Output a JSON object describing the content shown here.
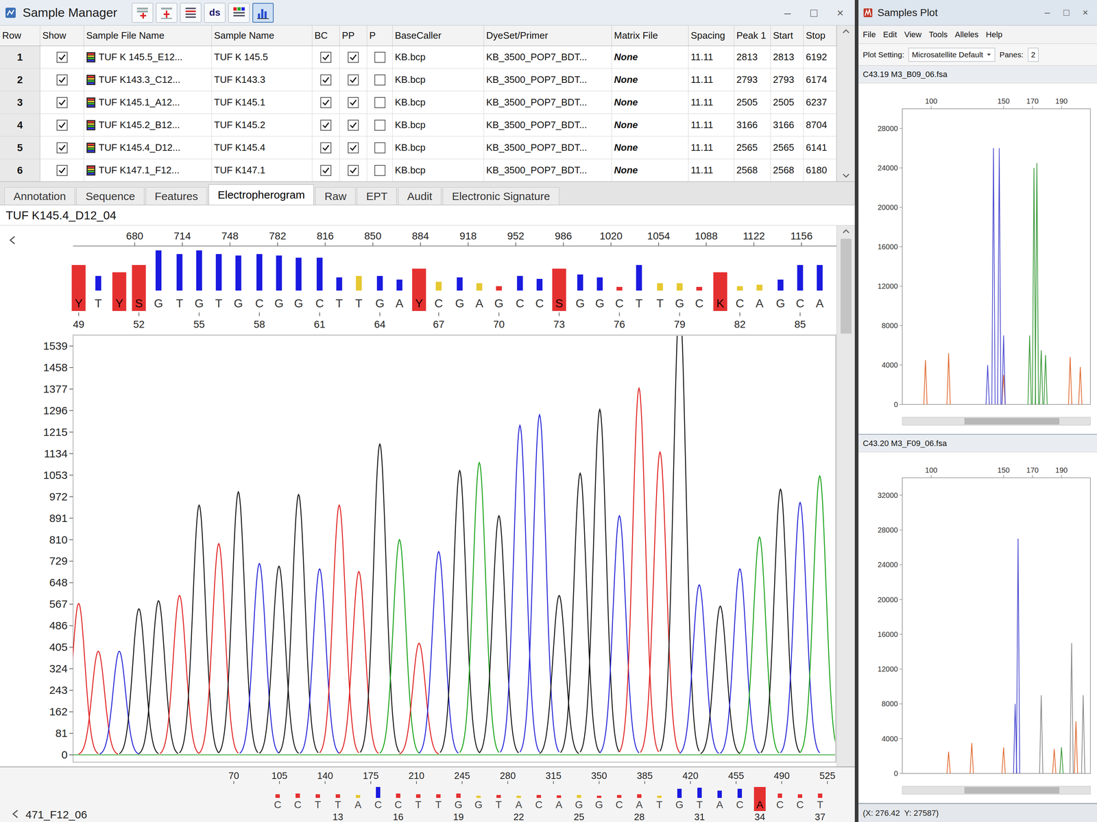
{
  "window": {
    "title": "Sample Manager",
    "controls": [
      "–",
      "□",
      "×"
    ]
  },
  "toolbar": [
    {
      "kind": "add",
      "selected": false
    },
    {
      "kind": "insert",
      "selected": false
    },
    {
      "kind": "align",
      "selected": false
    },
    {
      "kind": "text",
      "label": "ds",
      "selected": false
    },
    {
      "kind": "grid",
      "selected": false
    },
    {
      "kind": "chart",
      "selected": true
    }
  ],
  "table": {
    "columns": [
      "Row",
      "Show",
      "Sample File Name",
      "Sample Name",
      "BC",
      "PP",
      "P",
      "BaseCaller",
      "DyeSet/Primer",
      "Matrix File",
      "Spacing",
      "Peak 1",
      "Start",
      "Stop"
    ],
    "rows": [
      {
        "row": "1",
        "show": true,
        "file": "TUF K 145.5_E12...",
        "sample": "TUF K 145.5",
        "bc": true,
        "pp": true,
        "p": false,
        "basecaller": "KB.bcp",
        "dyeset": "KB_3500_POP7_BDT...",
        "matrix": "None",
        "spacing": "11.11",
        "peak1": "2813",
        "start": "2813",
        "stop": "6192"
      },
      {
        "row": "2",
        "show": true,
        "file": "TUF K143.3_C12...",
        "sample": "TUF K143.3",
        "bc": true,
        "pp": true,
        "p": false,
        "basecaller": "KB.bcp",
        "dyeset": "KB_3500_POP7_BDT...",
        "matrix": "None",
        "spacing": "11.11",
        "peak1": "2793",
        "start": "2793",
        "stop": "6174"
      },
      {
        "row": "3",
        "show": true,
        "file": "TUF K145.1_A12...",
        "sample": "TUF K145.1",
        "bc": true,
        "pp": true,
        "p": false,
        "basecaller": "KB.bcp",
        "dyeset": "KB_3500_POP7_BDT...",
        "matrix": "None",
        "spacing": "11.11",
        "peak1": "2505",
        "start": "2505",
        "stop": "6237"
      },
      {
        "row": "4",
        "show": true,
        "file": "TUF K145.2_B12...",
        "sample": "TUF K145.2",
        "bc": true,
        "pp": true,
        "p": false,
        "basecaller": "KB.bcp",
        "dyeset": "KB_3500_POP7_BDT...",
        "matrix": "None",
        "spacing": "11.11",
        "peak1": "3166",
        "start": "3166",
        "stop": "8704"
      },
      {
        "row": "5",
        "show": true,
        "file": "TUF K145.4_D12...",
        "sample": "TUF K145.4",
        "bc": true,
        "pp": true,
        "p": false,
        "basecaller": "KB.bcp",
        "dyeset": "KB_3500_POP7_BDT...",
        "matrix": "None",
        "spacing": "11.11",
        "peak1": "2565",
        "start": "2565",
        "stop": "6141"
      },
      {
        "row": "6",
        "show": true,
        "file": "TUF K147.1_F12...",
        "sample": "TUF K147.1",
        "bc": true,
        "pp": true,
        "p": false,
        "basecaller": "KB.bcp",
        "dyeset": "KB_3500_POP7_BDT...",
        "matrix": "None",
        "spacing": "11.11",
        "peak1": "2568",
        "start": "2568",
        "stop": "6180"
      }
    ]
  },
  "tabs": [
    {
      "label": "Annotation",
      "selected": false
    },
    {
      "label": "Sequence",
      "selected": false
    },
    {
      "label": "Features",
      "selected": false
    },
    {
      "label": "Electropherogram",
      "selected": true
    },
    {
      "label": "Raw",
      "selected": false
    },
    {
      "label": "EPT",
      "selected": false
    },
    {
      "label": "Audit",
      "selected": false
    },
    {
      "label": "Electronic Signature",
      "selected": false
    }
  ],
  "electropherogram": {
    "title": "TUF K145.4_D12_04",
    "scan_range": [
      636,
      1181
    ],
    "y_max": 1539,
    "x_ticks": [
      "680",
      "714",
      "748",
      "782",
      "816",
      "850",
      "884",
      "918",
      "952",
      "986",
      "1020",
      "1054",
      "1088",
      "1122",
      "1156"
    ],
    "y_ticks": [
      "1539",
      "1458",
      "1377",
      "1296",
      "1215",
      "1134",
      "1053",
      "972",
      "891",
      "810",
      "729",
      "648",
      "567",
      "486",
      "405",
      "324",
      "243",
      "162",
      "81",
      "0"
    ],
    "calls": [
      {
        "base": "Y",
        "scan": 640,
        "peak": 570,
        "color": "#e02020",
        "q": 0.35,
        "qc": "#e53030",
        "low": true,
        "num": "49"
      },
      {
        "base": "T",
        "scan": 654,
        "peak": 390,
        "color": "#e02020",
        "q": 0.2,
        "qc": "#1a1ae0",
        "low": false
      },
      {
        "base": "Y",
        "scan": 669,
        "peak": 390,
        "color": "#2525d8",
        "q": 0.25,
        "qc": "#e53030",
        "low": true
      },
      {
        "base": "S",
        "scan": 683,
        "peak": 550,
        "color": "#111111",
        "q": 0.35,
        "qc": "#e53030",
        "low": true,
        "num": "52"
      },
      {
        "base": "G",
        "scan": 697,
        "peak": 580,
        "color": "#111111",
        "q": 0.55,
        "qc": "#1a1ae0",
        "low": false
      },
      {
        "base": "T",
        "scan": 712,
        "peak": 600,
        "color": "#e02020",
        "q": 0.5,
        "qc": "#1a1ae0",
        "low": false
      },
      {
        "base": "G",
        "scan": 726,
        "peak": 940,
        "color": "#111111",
        "q": 0.55,
        "qc": "#1a1ae0",
        "low": false,
        "num": "55"
      },
      {
        "base": "T",
        "scan": 740,
        "peak": 795,
        "color": "#e02020",
        "q": 0.5,
        "qc": "#1a1ae0",
        "low": false
      },
      {
        "base": "G",
        "scan": 754,
        "peak": 990,
        "color": "#111111",
        "q": 0.48,
        "qc": "#1a1ae0",
        "low": false
      },
      {
        "base": "C",
        "scan": 769,
        "peak": 720,
        "color": "#2525d8",
        "q": 0.5,
        "qc": "#1a1ae0",
        "low": false,
        "num": "58"
      },
      {
        "base": "G",
        "scan": 783,
        "peak": 710,
        "color": "#111111",
        "q": 0.48,
        "qc": "#1a1ae0",
        "low": false
      },
      {
        "base": "G",
        "scan": 797,
        "peak": 980,
        "color": "#111111",
        "q": 0.45,
        "qc": "#1a1ae0",
        "low": false
      },
      {
        "base": "C",
        "scan": 812,
        "peak": 700,
        "color": "#2525d8",
        "q": 0.45,
        "qc": "#1a1ae0",
        "low": false,
        "num": "61"
      },
      {
        "base": "T",
        "scan": 826,
        "peak": 940,
        "color": "#e02020",
        "q": 0.18,
        "qc": "#1a1ae0",
        "low": false
      },
      {
        "base": "T",
        "scan": 840,
        "peak": 690,
        "color": "#e02020",
        "q": 0.2,
        "qc": "#e6c830",
        "low": false
      },
      {
        "base": "G",
        "scan": 855,
        "peak": 1170,
        "color": "#111111",
        "q": 0.2,
        "qc": "#1a1ae0",
        "low": false,
        "num": "64"
      },
      {
        "base": "A",
        "scan": 869,
        "peak": 810,
        "color": "#1aa31a",
        "q": 0.15,
        "qc": "#1a1ae0",
        "low": false
      },
      {
        "base": "Y",
        "scan": 883,
        "peak": 420,
        "color": "#e02020",
        "q": 0.3,
        "qc": "#e53030",
        "low": true
      },
      {
        "base": "C",
        "scan": 897,
        "peak": 765,
        "color": "#2525d8",
        "q": 0.12,
        "qc": "#e6c830",
        "low": false,
        "num": "67"
      },
      {
        "base": "G",
        "scan": 912,
        "peak": 1070,
        "color": "#111111",
        "q": 0.18,
        "qc": "#1a1ae0",
        "low": false
      },
      {
        "base": "A",
        "scan": 926,
        "peak": 1100,
        "color": "#1aa31a",
        "q": 0.1,
        "qc": "#e6c830",
        "low": false
      },
      {
        "base": "G",
        "scan": 940,
        "peak": 900,
        "color": "#111111",
        "q": 0.06,
        "qc": "#e53030",
        "low": false,
        "num": "70"
      },
      {
        "base": "C",
        "scan": 955,
        "peak": 1240,
        "color": "#2525d8",
        "q": 0.2,
        "qc": "#1a1ae0",
        "low": false
      },
      {
        "base": "C",
        "scan": 969,
        "peak": 1280,
        "color": "#2525d8",
        "q": 0.16,
        "qc": "#1a1ae0",
        "low": false
      },
      {
        "base": "S",
        "scan": 983,
        "peak": 600,
        "color": "#111111",
        "q": 0.3,
        "qc": "#e53030",
        "low": true,
        "num": "73"
      },
      {
        "base": "G",
        "scan": 998,
        "peak": 1060,
        "color": "#111111",
        "q": 0.22,
        "qc": "#1a1ae0",
        "low": false
      },
      {
        "base": "G",
        "scan": 1012,
        "peak": 1300,
        "color": "#111111",
        "q": 0.18,
        "qc": "#1a1ae0",
        "low": false
      },
      {
        "base": "C",
        "scan": 1026,
        "peak": 900,
        "color": "#2525d8",
        "q": 0.05,
        "qc": "#e53030",
        "low": false,
        "num": "76"
      },
      {
        "base": "T",
        "scan": 1040,
        "peak": 1380,
        "color": "#e02020",
        "q": 0.35,
        "qc": "#1a1ae0",
        "low": false
      },
      {
        "base": "T",
        "scan": 1055,
        "peak": 1140,
        "color": "#e02020",
        "q": 0.1,
        "qc": "#e6c830",
        "low": false
      },
      {
        "base": "G",
        "scan": 1069,
        "peak": 1700,
        "color": "#111111",
        "q": 0.1,
        "qc": "#e6c830",
        "low": false,
        "num": "79"
      },
      {
        "base": "C",
        "scan": 1083,
        "peak": 640,
        "color": "#2525d8",
        "q": 0.05,
        "qc": "#e53030",
        "low": false
      },
      {
        "base": "K",
        "scan": 1098,
        "peak": 560,
        "color": "#111111",
        "q": 0.25,
        "qc": "#e53030",
        "low": true
      },
      {
        "base": "C",
        "scan": 1112,
        "peak": 700,
        "color": "#2525d8",
        "q": 0.06,
        "qc": "#e6c830",
        "low": false,
        "num": "82"
      },
      {
        "base": "A",
        "scan": 1126,
        "peak": 820,
        "color": "#1aa31a",
        "q": 0.08,
        "qc": "#e6c830",
        "low": false
      },
      {
        "base": "G",
        "scan": 1141,
        "peak": 1000,
        "color": "#111111",
        "q": 0.15,
        "qc": "#1a1ae0",
        "low": false
      },
      {
        "base": "C",
        "scan": 1155,
        "peak": 950,
        "color": "#2525d8",
        "q": 0.35,
        "qc": "#1a1ae0",
        "low": false,
        "num": "85"
      },
      {
        "base": "A",
        "scan": 1169,
        "peak": 1050,
        "color": "#1aa31a",
        "q": 0.35,
        "qc": "#1a1ae0",
        "low": false
      }
    ]
  },
  "lower_panel": {
    "title": "471_F12_06",
    "x_ticks": [
      "70",
      "105",
      "140",
      "175",
      "210",
      "245",
      "280",
      "315",
      "350",
      "385",
      "420",
      "455",
      "490",
      "525"
    ],
    "calls": [
      {
        "base": "C",
        "q": 0.1,
        "qc": "#e53030",
        "low": false
      },
      {
        "base": "C",
        "q": 0.12,
        "qc": "#e53030",
        "low": false
      },
      {
        "base": "T",
        "q": 0.1,
        "qc": "#e53030",
        "low": false
      },
      {
        "base": "T",
        "q": 0.1,
        "qc": "#e53030",
        "low": false,
        "num": "13"
      },
      {
        "base": "A",
        "q": 0.08,
        "qc": "#e6c830",
        "low": false
      },
      {
        "base": "C",
        "q": 0.3,
        "qc": "#1a1ae0",
        "low": false
      },
      {
        "base": "C",
        "q": 0.12,
        "qc": "#e53030",
        "low": false,
        "num": "16"
      },
      {
        "base": "T",
        "q": 0.1,
        "qc": "#e53030",
        "low": false
      },
      {
        "base": "T",
        "q": 0.1,
        "qc": "#e53030",
        "low": false
      },
      {
        "base": "G",
        "q": 0.12,
        "qc": "#e53030",
        "low": false,
        "num": "19"
      },
      {
        "base": "G",
        "q": 0.06,
        "qc": "#e6c830",
        "low": false
      },
      {
        "base": "T",
        "q": 0.08,
        "qc": "#e53030",
        "low": false
      },
      {
        "base": "A",
        "q": 0.06,
        "qc": "#e6c830",
        "low": false,
        "num": "22"
      },
      {
        "base": "C",
        "q": 0.08,
        "qc": "#e53030",
        "low": false
      },
      {
        "base": "A",
        "q": 0.07,
        "qc": "#e53030",
        "low": false
      },
      {
        "base": "G",
        "q": 0.08,
        "qc": "#e6c830",
        "low": false,
        "num": "25"
      },
      {
        "base": "G",
        "q": 0.06,
        "qc": "#e53030",
        "low": false
      },
      {
        "base": "C",
        "q": 0.08,
        "qc": "#e53030",
        "low": false
      },
      {
        "base": "A",
        "q": 0.1,
        "qc": "#e53030",
        "low": false,
        "num": "28"
      },
      {
        "base": "T",
        "q": 0.06,
        "qc": "#e6c830",
        "low": false
      },
      {
        "base": "G",
        "q": 0.25,
        "qc": "#1a1ae0",
        "low": false
      },
      {
        "base": "T",
        "q": 0.28,
        "qc": "#1a1ae0",
        "low": false,
        "num": "31"
      },
      {
        "base": "A",
        "q": 0.2,
        "qc": "#1a1ae0",
        "low": false
      },
      {
        "base": "C",
        "q": 0.25,
        "qc": "#1a1ae0",
        "low": false
      },
      {
        "base": "A",
        "q": 0.3,
        "qc": "#e53030",
        "low": true,
        "num": "34"
      },
      {
        "base": "C",
        "q": 0.12,
        "qc": "#e53030",
        "low": false
      },
      {
        "base": "C",
        "q": 0.1,
        "qc": "#e53030",
        "low": false
      },
      {
        "base": "T",
        "q": 0.12,
        "qc": "#e53030",
        "low": false,
        "num": "37"
      }
    ]
  },
  "plot_window": {
    "title": "Samples Plot",
    "controls": [
      "–",
      "□",
      "×"
    ],
    "menu": [
      "File",
      "Edit",
      "View",
      "Tools",
      "Alleles",
      "Help"
    ],
    "plot_setting_label": "Plot Setting:",
    "plot_setting": "Microsatellite Default",
    "panes_label": "Panes:",
    "panes": "2",
    "plots": [
      {
        "title": "C43.19 M3_B09_06.fsa",
        "x_range": [
          80,
          210
        ],
        "y_max": 30000,
        "x_ticks": [
          "100",
          "150",
          "170",
          "190"
        ],
        "y_ticks": [
          "28000",
          "24000",
          "20000",
          "16000",
          "12000",
          "8000",
          "4000",
          "0"
        ],
        "series": [
          {
            "color": "#e06a30",
            "peaks": [
              [
                96,
                4500
              ],
              [
                112,
                5200
              ],
              [
                150,
                3000
              ],
              [
                196,
                4800
              ],
              [
                203,
                3800
              ]
            ]
          },
          {
            "color": "#4a4ad0",
            "peaks": [
              [
                139,
                4000
              ],
              [
                143,
                26000
              ],
              [
                147,
                26000
              ],
              [
                150,
                7000
              ]
            ]
          },
          {
            "color": "#3a9a3a",
            "peaks": [
              [
                168,
                7000
              ],
              [
                171,
                24000
              ],
              [
                173,
                24500
              ],
              [
                176,
                5500
              ],
              [
                179,
                5000
              ]
            ]
          }
        ]
      },
      {
        "title": "C43.20 M3_F09_06.fsa",
        "x_range": [
          80,
          210
        ],
        "y_max": 34000,
        "x_ticks": [
          "100",
          "150",
          "170",
          "190"
        ],
        "y_ticks": [
          "32000",
          "28000",
          "24000",
          "20000",
          "16000",
          "12000",
          "8000",
          "4000",
          "0"
        ],
        "series": [
          {
            "color": "#e06a30",
            "peaks": [
              [
                112,
                2500
              ],
              [
                128,
                3500
              ],
              [
                150,
                3000
              ],
              [
                185,
                2800
              ],
              [
                200,
                6000
              ]
            ]
          },
          {
            "color": "#4a4ad0",
            "peaks": [
              [
                158,
                8000
              ],
              [
                160,
                27000
              ]
            ]
          },
          {
            "color": "#8a8a8a",
            "peaks": [
              [
                176,
                9000
              ],
              [
                197,
                15000
              ],
              [
                205,
                9000
              ]
            ]
          },
          {
            "color": "#3a9a3a",
            "peaks": [
              [
                190,
                3000
              ]
            ]
          }
        ]
      }
    ],
    "status": "(X: 276.42  Y: 27587)"
  }
}
